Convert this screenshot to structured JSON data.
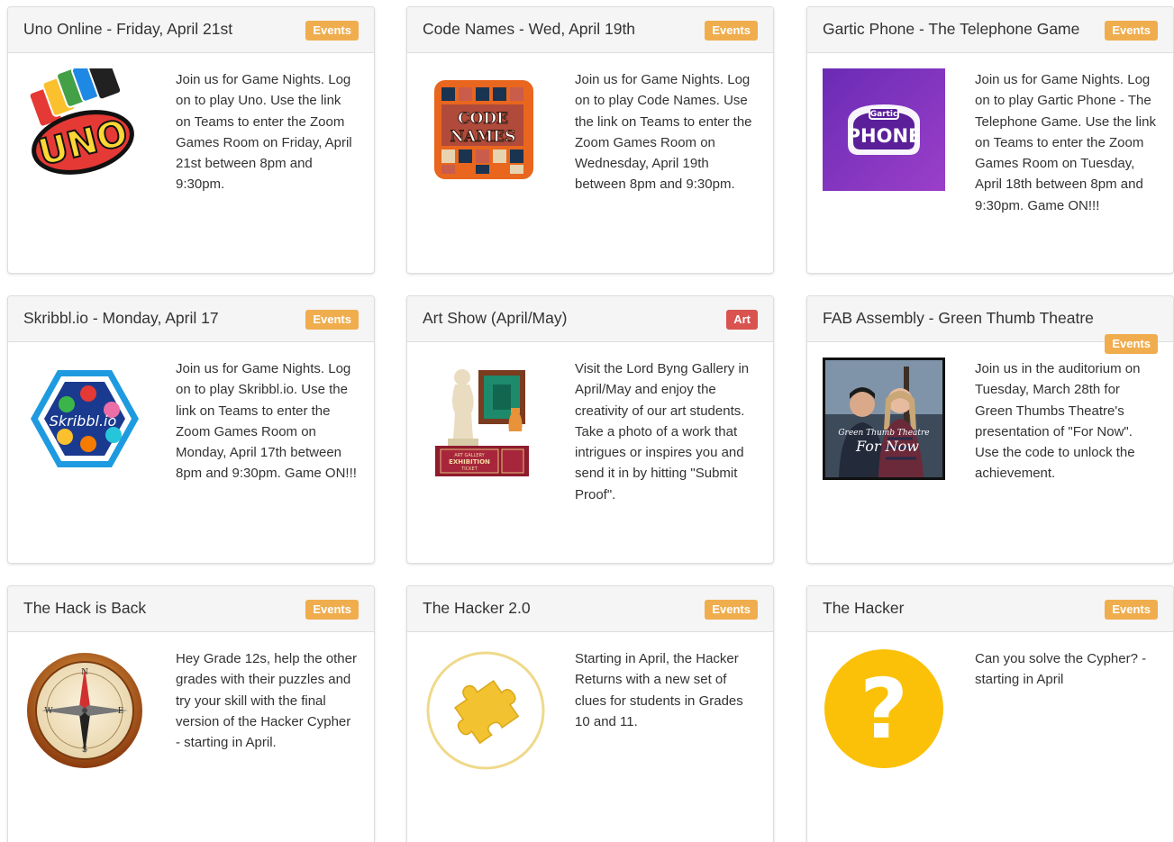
{
  "colors": {
    "events_badge": "#f0ad4e",
    "art_badge": "#d9534f",
    "header_bg": "#f5f5f5"
  },
  "cards": [
    {
      "title": "Uno Online - Friday, April 21st",
      "badge": "Events",
      "image": "uno-logo",
      "description": "Join us for Game Nights. Log on to play Uno. Use the link on Teams to enter the Zoom Games Room on Friday, April 21st between 8pm and 9:30pm."
    },
    {
      "title": "Code Names - Wed, April 19th",
      "badge": "Events",
      "image": "code-names-logo",
      "image_text_line1": "CODE",
      "image_text_line2": "NAMES",
      "description": "Join us for Game Nights. Log on to play Code Names. Use the link on Teams to enter the Zoom Games Room on Wednesday, April 19th between 8pm and 9:30pm."
    },
    {
      "title": "Gartic Phone - The Telephone Game",
      "badge": "Events",
      "image": "gartic-phone-logo",
      "image_text_small": "Gartic",
      "image_text_big": "PHONE",
      "description": "Join us for Game Nights. Log on to play Gartic Phone - The Telephone Game. Use the link on Teams to enter the Zoom Games Room on Tuesday, April 18th between 8pm and 9:30pm. Game ON!!!"
    },
    {
      "title": "Skribbl.io - Monday, April 17",
      "badge": "Events",
      "image": "skribbl-logo",
      "image_text": "Skribbl.io",
      "description": "Join us for Game Nights. Log on to play Skribbl.io. Use the link on Teams to enter the Zoom Games Room on Monday, April 17th between 8pm and 9:30pm. Game ON!!!"
    },
    {
      "title": "Art Show (April/May)",
      "badge": "Art",
      "image": "art-gallery-icon",
      "image_text_line1": "ART GALLERY",
      "image_text_line2": "EXHIBITION",
      "image_text_line3": "TICKET",
      "description": "Visit the Lord Byng Gallery in April/May and enjoy the creativity of our art students. Take a photo of a work that intrigues or inspires you and send it in by hitting \"Submit Proof\"."
    },
    {
      "title": "FAB Assembly - Green Thumb Theatre",
      "badge": "Events",
      "image": "theatre-poster",
      "image_text_line1": "Green Thumb Theatre",
      "image_text_line2": "For Now",
      "description": "Join us in the auditorium on Tuesday, March 28th for Green Thumbs Theatre's presentation of \"For Now\". Use the code to unlock the achievement."
    },
    {
      "title": "The Hack is Back",
      "badge": "Events",
      "image": "compass-icon",
      "image_text_n": "N",
      "image_text_e": "E",
      "image_text_w": "W",
      "image_text_s": "S",
      "description": "Hey Grade 12s, help the other grades with their puzzles and try your skill with the final version of the Hacker Cypher - starting in April."
    },
    {
      "title": "The Hacker 2.0",
      "badge": "Events",
      "image": "puzzle-piece-icon",
      "description": "Starting in April, the Hacker Returns with a new set of clues for students in Grades 10 and 11."
    },
    {
      "title": "The Hacker",
      "badge": "Events",
      "image": "question-mark-icon",
      "image_text": "?",
      "description": "Can you solve the Cypher? - starting in April"
    }
  ]
}
